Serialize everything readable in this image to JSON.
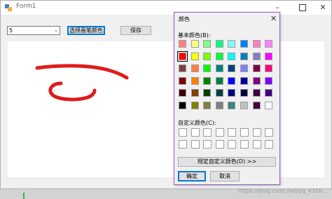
{
  "window": {
    "title": "Form1",
    "minimize": "–",
    "close": "✕"
  },
  "toolbar": {
    "combo_value": "5",
    "combo_arrow": "⌄",
    "choose_color_label": "选择画笔颜色",
    "save_label": "保存"
  },
  "strokes": {
    "color": "#e01b1b",
    "width": 5
  },
  "color_dialog": {
    "title": "颜色",
    "close": "✕",
    "basic_colors_label": "基本颜色(B):",
    "basic_colors": [
      [
        "#ff8080",
        "#ffff80",
        "#80ff80",
        "#00ff80",
        "#80ffff",
        "#0080ff",
        "#ff80c0",
        "#ff80ff"
      ],
      [
        "#ff0000",
        "#ffff00",
        "#80ff00",
        "#00ff40",
        "#00ffff",
        "#0080c0",
        "#8080c0",
        "#ff00ff"
      ],
      [
        "#804040",
        "#ff8040",
        "#00ff00",
        "#008080",
        "#004080",
        "#8080ff",
        "#800040",
        "#ff0080"
      ],
      [
        "#800000",
        "#ff8000",
        "#008000",
        "#008040",
        "#0000ff",
        "#0000a0",
        "#800080",
        "#8000ff"
      ],
      [
        "#400000",
        "#804000",
        "#004000",
        "#004040",
        "#000080",
        "#000040",
        "#400040",
        "#400080"
      ],
      [
        "#000000",
        "#808000",
        "#808040",
        "#808080",
        "#408080",
        "#c0c0c0",
        "#400040",
        "#ffffff"
      ]
    ],
    "selected": "#ff0000",
    "custom_colors_label": "自定义颜色(C):",
    "define_custom_label": "规定自定义颜色(D) >>",
    "ok_label": "确定",
    "cancel_label": "取消"
  },
  "watermark": "https://blog.csdn.net/qq_4316..."
}
